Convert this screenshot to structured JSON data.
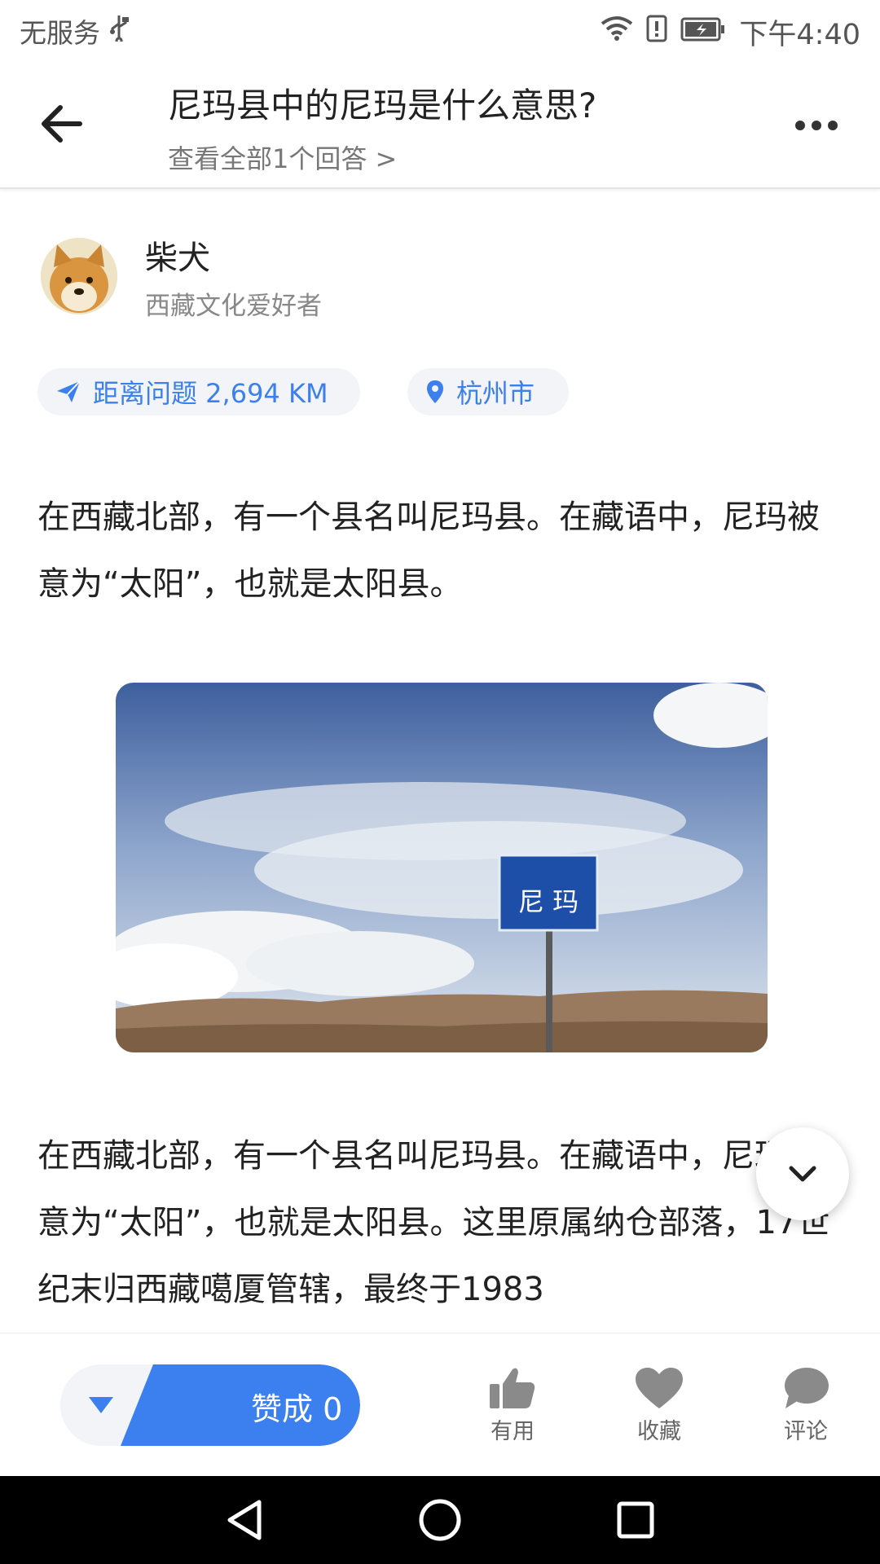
{
  "status_bar": {
    "carrier": "无服务",
    "time": "下午4:40",
    "icons": [
      "usb-icon",
      "wifi-icon",
      "alert-icon",
      "battery-icon"
    ]
  },
  "header": {
    "title": "尼玛县中的尼玛是什么意思?",
    "subtitle": "查看全部1个回答 >"
  },
  "author": {
    "name": "柴犬",
    "description": "西藏文化爱好者"
  },
  "chips": {
    "distance": "距离问题 2,694 KM",
    "location": "杭州市"
  },
  "content": {
    "paragraph_1": "在西藏北部，有一个县名叫尼玛县。在藏语中，尼玛被意为“太阳”，也就是太阳县。",
    "sign_text": "尼 玛",
    "paragraph_2": "在西藏北部，有一个县名叫尼玛县。在藏语中，尼玛被意为“太阳”，也就是太阳县。这里原属纳仓部落，17世纪末归西藏噶厦管辖，最终于1983"
  },
  "action_bar": {
    "vote_label": "赞成 0",
    "useful": "有用",
    "favorite": "收藏",
    "comment": "评论"
  },
  "colors": {
    "accent": "#3b80ee",
    "chip_bg": "#f2f4f7",
    "icon_gray": "#8a8a8a"
  }
}
